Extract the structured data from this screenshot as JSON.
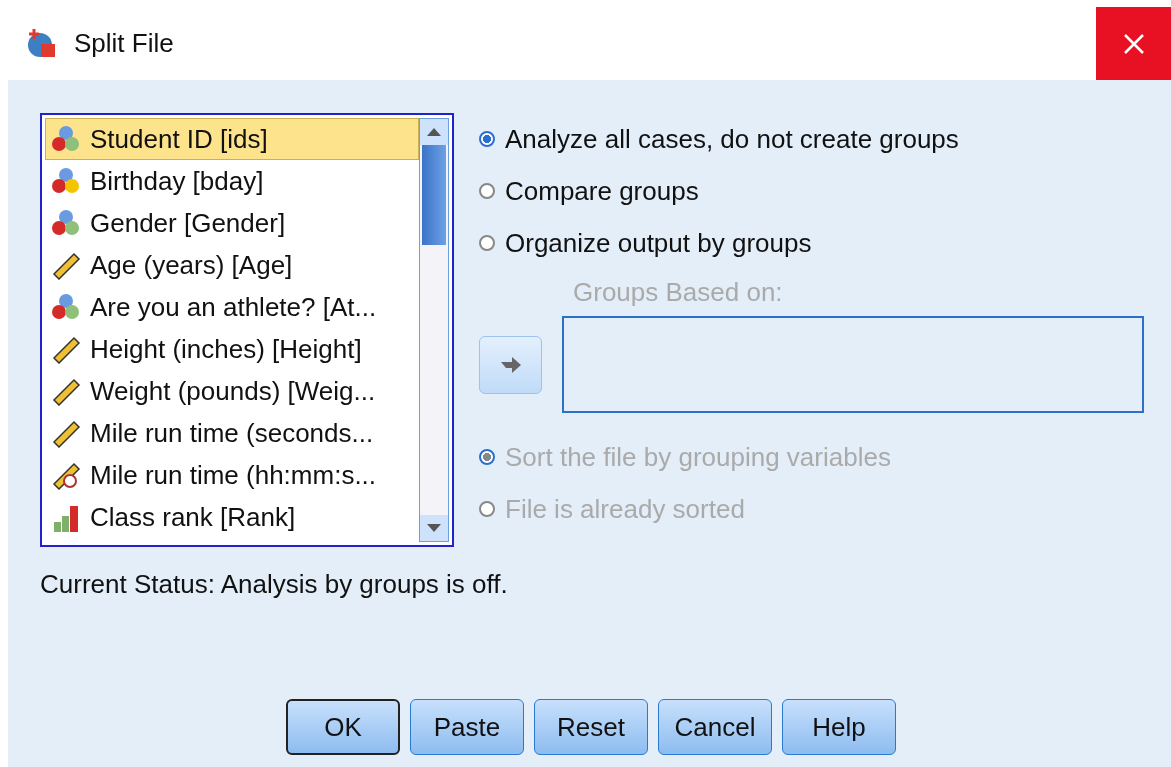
{
  "window": {
    "title": "Split File"
  },
  "variables": [
    {
      "kind": "nominal",
      "label": "Student ID [ids]",
      "selected": true
    },
    {
      "kind": "string",
      "label": "Birthday [bday]",
      "selected": false
    },
    {
      "kind": "nominal",
      "label": "Gender [Gender]",
      "selected": false
    },
    {
      "kind": "scale",
      "label": "Age (years) [Age]",
      "selected": false
    },
    {
      "kind": "nominal",
      "label": "Are you an athlete? [At...",
      "selected": false
    },
    {
      "kind": "scale",
      "label": "Height (inches) [Height]",
      "selected": false
    },
    {
      "kind": "scale",
      "label": "Weight (pounds) [Weig...",
      "selected": false
    },
    {
      "kind": "scale",
      "label": "Mile run time (seconds...",
      "selected": false
    },
    {
      "kind": "time",
      "label": "Mile run time (hh:mm:s...",
      "selected": false
    },
    {
      "kind": "ordinal",
      "label": "Class rank [Rank]",
      "selected": false
    }
  ],
  "mode_options": [
    {
      "label": "Analyze all cases, do not create groups",
      "selected": true,
      "disabled": false
    },
    {
      "label": "Compare groups",
      "selected": false,
      "disabled": false
    },
    {
      "label": "Organize output by groups",
      "selected": false,
      "disabled": false
    }
  ],
  "groups_based_on": {
    "label": "Groups Based on:",
    "disabled": true
  },
  "sort_options": [
    {
      "label": "Sort the file by grouping variables",
      "selected": true,
      "disabled": true
    },
    {
      "label": "File is already sorted",
      "selected": false,
      "disabled": true
    }
  ],
  "status": "Current Status: Analysis by groups is off.",
  "buttons": [
    {
      "label": "OK",
      "default": true
    },
    {
      "label": "Paste",
      "default": false
    },
    {
      "label": "Reset",
      "default": false
    },
    {
      "label": "Cancel",
      "default": false
    },
    {
      "label": "Help",
      "default": false
    }
  ]
}
